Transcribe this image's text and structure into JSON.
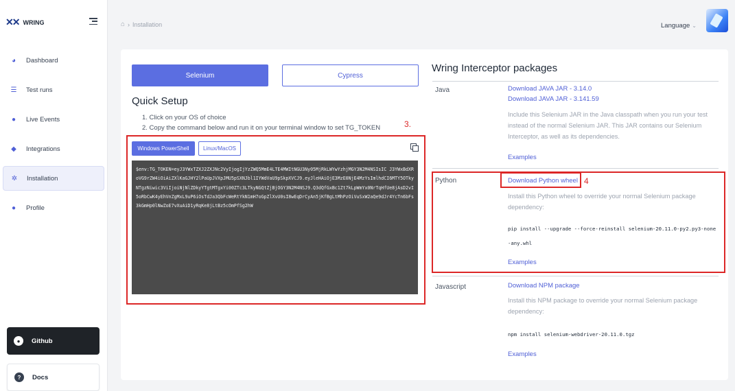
{
  "app": {
    "logo_text": "WRING"
  },
  "sidebar": {
    "items": [
      {
        "label": "Dashboard",
        "icon": "pie-chart-icon"
      },
      {
        "label": "Test runs",
        "icon": "list-icon"
      },
      {
        "label": "Live Events",
        "icon": "lightbulb-icon"
      },
      {
        "label": "Integrations",
        "icon": "cube-icon"
      },
      {
        "label": "Installation",
        "icon": "gear-icon",
        "active": true
      },
      {
        "label": "Profile",
        "icon": "user-icon"
      }
    ],
    "github_label": "Github",
    "docs_label": "Docs"
  },
  "header": {
    "breadcrumb": "Installation",
    "language_label": "Language"
  },
  "tabs": {
    "selenium": "Selenium",
    "cypress": "Cypress"
  },
  "quick_setup": {
    "title": "Quick Setup",
    "step1": "1. Click on your OS of choice",
    "step2": "2. Copy the command below and run it on your terminal window to set TG_TOKEN",
    "os_windows": "Windows PowerShell",
    "os_linux": "Linux/MacOS",
    "command": "$env:TG_TOKEN=eyJ3YWxTZXJ2ZXJNc2VyIjogIjYzZWQ5MmE4LTE4MWItNGU3Ny05MjRkLWYwYzhjMGY3N2M4NSIsIC J3YWxBdXRoVG9rZW4iOiAiZXlKaGJHY2lPaUpJVXpJMU5pSXNJbl1IYWdVaU9pSkpXVCJ9.eyJleHAiOjE3MzE0NjE4MzYsImlhdCI6MTY5OTkyNTgzNiwic3ViIjoiNjNlZDkyYTgtMTgxYi00ZTc3LTkyNGQtZjBjOGY3N2M4NSJ9.Q3dQfGxBc1Zt7kLpWmYx0NrTqHfUe8jAsD2vI5oRbCwK4yEhVnZgMxL9uP6iOsTdJa3QbFcWeRtYkN1mH7oGpZlXvU0sI8wEqDrCyAn5jKfBgLtMhPzOiVuSxW2aQe9dJr4YcTn6bFs3kGmHp0lNwZoE7vXuAiD1yRqKe8jLtBz5cOmPfSg2hW",
    "annotation": "3."
  },
  "packages": {
    "title": "Wring Interceptor packages",
    "java": {
      "label": "Java",
      "link1": "Download JAVA JAR - 3.14.0",
      "link2": "Download JAVA JAR - 3.141.59",
      "desc": "Include this Selenium JAR in the Java classpath when you run your test instead of the normal Selenium JAR. This JAR contains our Selenium Interceptor, as well as its dependencies.",
      "examples": "Examples"
    },
    "python": {
      "label": "Python",
      "link": "Download Python wheel",
      "annotation": "4",
      "desc": "Install this Python wheel to override your normal Selenium package dependency:",
      "cmd": "pip install --upgrade --force-reinstall selenium-20.11.0-py2.py3-none-any.whl",
      "examples": "Examples"
    },
    "javascript": {
      "label": "Javascript",
      "link": "Download NPM package",
      "desc": "Install this NPM package to override your normal Selenium package dependency:",
      "cmd": "npm install selenium-webdriver-20.11.0.tgz",
      "examples": "Examples"
    }
  },
  "colors": {
    "accent": "#5b6ee1",
    "annotation": "#dc2626",
    "code_bg": "#4b4b4b"
  }
}
